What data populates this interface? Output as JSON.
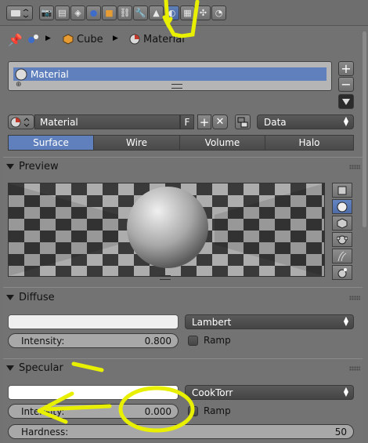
{
  "breadcrumb": {
    "object": "Cube",
    "material": "Material"
  },
  "material_slots": {
    "items": [
      "Material"
    ]
  },
  "material_selector": {
    "name": "Material",
    "fake_user": "F",
    "link": "Data"
  },
  "tabs": [
    {
      "label": "Surface",
      "active": true
    },
    {
      "label": "Wire",
      "active": false
    },
    {
      "label": "Volume",
      "active": false
    },
    {
      "label": "Halo",
      "active": false
    }
  ],
  "preview": {
    "title": "Preview"
  },
  "diffuse": {
    "title": "Diffuse",
    "shader": "Lambert",
    "intensity_label": "Intensity:",
    "intensity": "0.800",
    "ramp_label": "Ramp",
    "color": "#efefef"
  },
  "specular": {
    "title": "Specular",
    "shader": "CookTorr",
    "intensity_label": "Intensity:",
    "intensity": "0.000",
    "ramp_label": "Ramp",
    "hardness_label": "Hardness:",
    "hardness": "50",
    "color": "#ffffff"
  },
  "colors": {
    "accent": "#5f80bd",
    "annotation": "#e8f000"
  },
  "icons": [
    "render-icon",
    "render-layers-icon",
    "scene-icon",
    "world-icon",
    "object-icon",
    "constraints-icon",
    "modifiers-icon",
    "data-icon",
    "material-icon",
    "texture-icon",
    "particles-icon",
    "physics-icon"
  ]
}
